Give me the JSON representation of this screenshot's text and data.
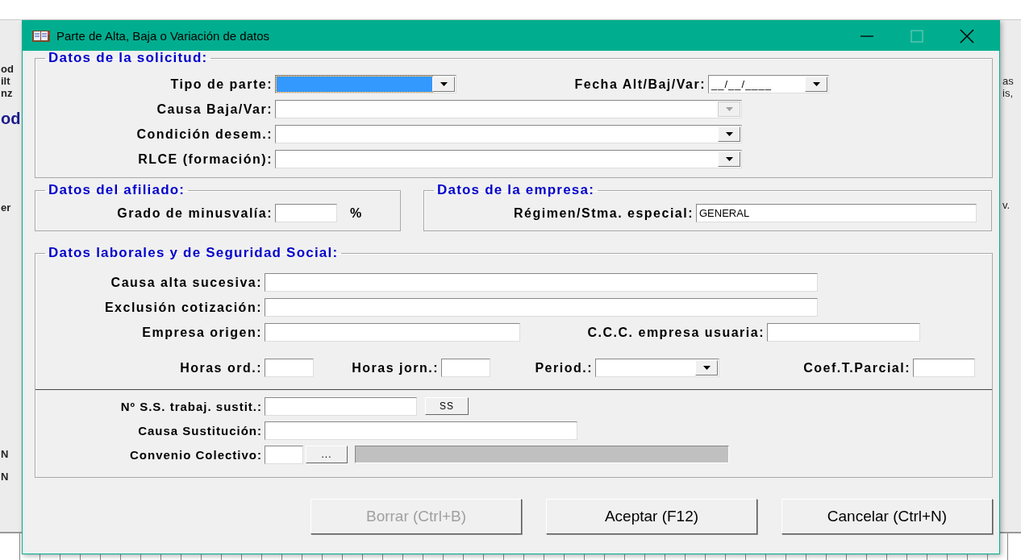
{
  "window": {
    "title": "Parte de Alta, Baja o Variación de datos"
  },
  "background_fragments": {
    "left": [
      "od",
      "ilt",
      "nz",
      "od",
      "er",
      "N",
      "N"
    ],
    "right": [
      "as",
      "is,",
      "v."
    ]
  },
  "solicitud": {
    "legend": "Datos de la solicitud:",
    "combos": [
      {
        "label": "Tipo de parte:",
        "highlighted": true,
        "disabled": false
      },
      {
        "label": "Causa Baja/Var:",
        "highlighted": false,
        "disabled": true
      },
      {
        "label": "Condición desem.:",
        "highlighted": false,
        "disabled": false
      },
      {
        "label": "RLCE (formación):",
        "highlighted": false,
        "disabled": false
      }
    ],
    "fecha": {
      "label": "Fecha Alt/Baj/Var:",
      "value": "__/__/____"
    }
  },
  "afiliado": {
    "legend": "Datos del afiliado:",
    "label": "Grado de minusvalía:",
    "unit": "%"
  },
  "empresa": {
    "legend": "Datos de la empresa:",
    "label": "Régimen/Stma. especial:",
    "value": "GENERAL"
  },
  "laborales": {
    "legend": "Datos laborales y de Seguridad Social:",
    "causa_alta_sucesiva": "Causa alta sucesiva:",
    "exclusion_cotizacion": "Exclusión cotización:",
    "empresa_origen": "Empresa origen:",
    "ccc_empresa_usuaria": "C.C.C. empresa usuaria:",
    "horas_ord": "Horas ord.:",
    "horas_jorn": "Horas jorn.:",
    "period": "Period.:",
    "coef_parcial": "Coef.T.Parcial:",
    "ns_trabajador": "Nº S.S. trabaj. sustit.:",
    "ss_button": "SS",
    "causa_sustitucion": "Causa Sustitución:",
    "convenio": "Convenio Colectivo:",
    "browse_button": "..."
  },
  "buttons": [
    {
      "label": "Borrar (Ctrl+B)",
      "disabled": true
    },
    {
      "label": "Aceptar (F12)",
      "disabled": false
    },
    {
      "label": "Cancelar (Ctrl+N)",
      "disabled": false
    }
  ]
}
